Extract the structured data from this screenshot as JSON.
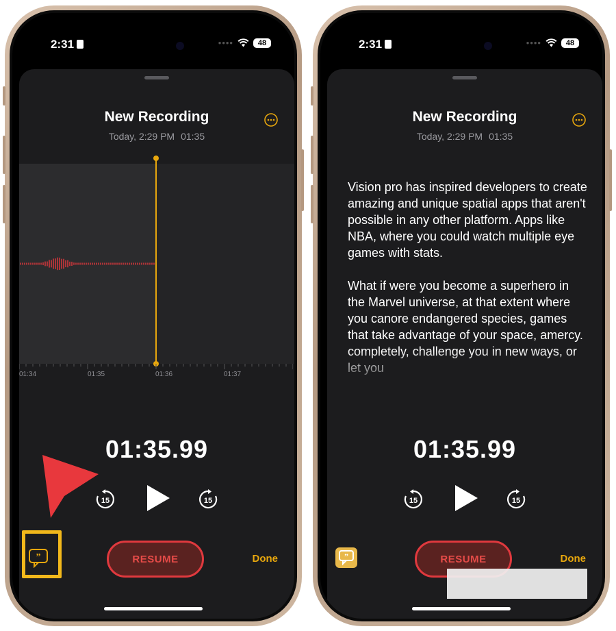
{
  "left_phone": {
    "status": {
      "time": "2:31",
      "battery": "48"
    },
    "title": "New Recording",
    "date": "Today, 2:29 PM",
    "duration": "01:35",
    "timeline_ticks": [
      "01:34",
      "01:35",
      "01:36",
      "01:37"
    ],
    "timer": "01:35.99",
    "resume_label": "RESUME",
    "done_label": "Done",
    "icons": [
      "more-icon",
      "skip-back-15-icon",
      "play-icon",
      "skip-forward-15-icon",
      "transcript-icon"
    ]
  },
  "right_phone": {
    "status": {
      "time": "2:31",
      "battery": "48"
    },
    "title": "New Recording",
    "date": "Today, 2:29 PM",
    "duration": "01:35",
    "transcript": [
      "Vision pro has inspired developers to create amazing and unique spatial apps that aren't possible in any other platform. Apps like NBA, where you could watch multiple eye games with stats.",
      "What if were you become a superhero in the Marvel universe, at that extent where you canore endangered species, games that take advantage of your space, amercy.  completely, challenge you in new ways, or let you"
    ],
    "timer": "01:35.99",
    "resume_label": "RESUME",
    "done_label": "Done"
  },
  "colors": {
    "accent": "#e8a70d",
    "record_red": "#e0393e",
    "highlight": "#f2b81b",
    "arrow": "#e8383d"
  }
}
